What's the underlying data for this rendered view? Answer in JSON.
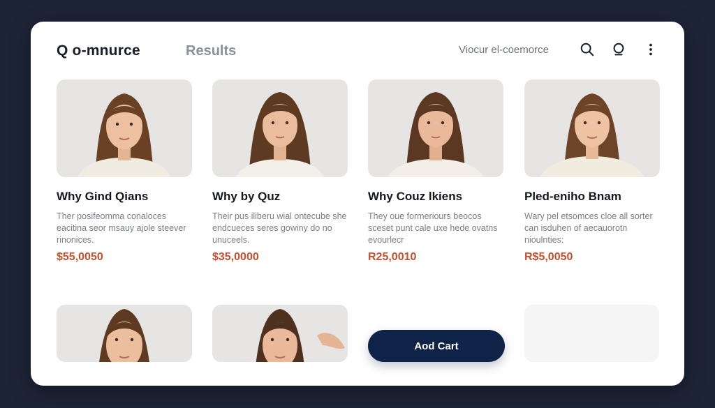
{
  "header": {
    "brand_icon": "Q",
    "brand_name": "o-mnurce",
    "results_tab": "Results",
    "store_link": "Viocur el-coemorce",
    "icons": [
      "search-icon",
      "user-icon",
      "more-vertical-icon"
    ]
  },
  "products": [
    {
      "title": "Why Gind Qians",
      "desc": "Ther posifeomma conaloces eacitina seor msauy ajole steever rinonices.",
      "price": "$55,0050"
    },
    {
      "title": "Why by Quz",
      "desc": "Their pus iliberu wial ontecube she endcueces seres gowiny do no unuceels.",
      "price": "$35,0000"
    },
    {
      "title": "Why Couz lkiens",
      "desc": "They oue formeriours beocos sceset punt cale uxe hede ovatns evourlecr",
      "price": "R25,0010"
    },
    {
      "title": "Pled-eniho Bnam",
      "desc": "Wary pel etsomces cloe all sorter can isduhen of aecauorotn nioulnties:",
      "price": "R$5,0050"
    }
  ],
  "actions": {
    "add_cart": "Aod Cart"
  },
  "colors": {
    "background": "#1e2437",
    "price": "#c2502f",
    "button": "#0f2247"
  }
}
